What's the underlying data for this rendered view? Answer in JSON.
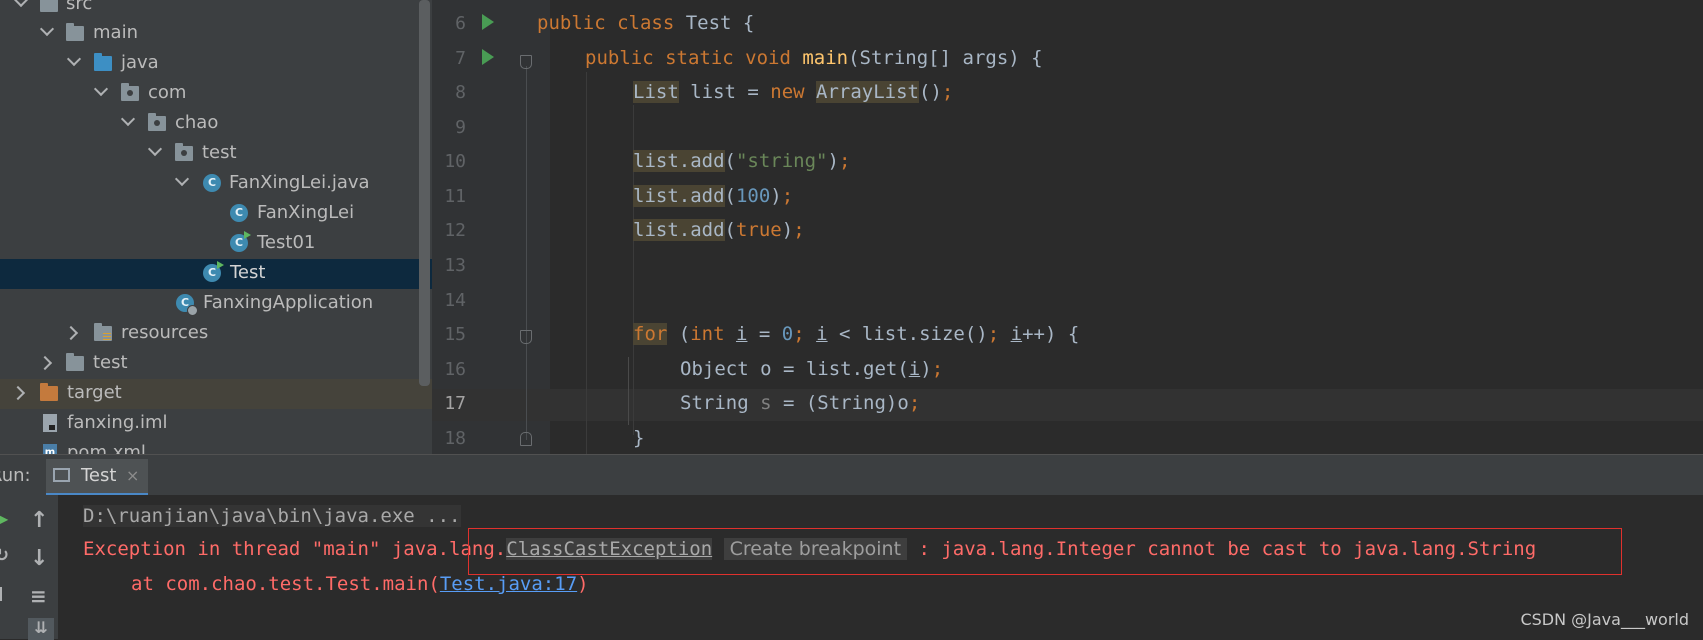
{
  "tree": [
    {
      "label": "src",
      "icon": "folder-icon",
      "expanded": true
    },
    {
      "label": "main",
      "icon": "folder-icon",
      "expanded": true
    },
    {
      "label": "java",
      "icon": "source-folder-icon",
      "expanded": true
    },
    {
      "label": "com",
      "icon": "package-icon",
      "expanded": true
    },
    {
      "label": "chao",
      "icon": "package-icon",
      "expanded": true
    },
    {
      "label": "test",
      "icon": "package-icon",
      "expanded": true
    },
    {
      "label": "FanXingLei.java",
      "icon": "class-file-icon",
      "expanded": true
    },
    {
      "label": "FanXingLei",
      "icon": "class-icon"
    },
    {
      "label": "Test01",
      "icon": "runnable-class-icon"
    },
    {
      "label": "Test",
      "icon": "runnable-class-icon",
      "selected": true
    },
    {
      "label": "FanxingApplication",
      "icon": "spring-app-class-icon"
    },
    {
      "label": "resources",
      "icon": "resources-folder-icon",
      "expanded": false
    },
    {
      "label": "test",
      "icon": "folder-icon",
      "expanded": false
    },
    {
      "label": "target",
      "icon": "excluded-folder-icon",
      "expanded": false
    },
    {
      "label": "fanxing.iml",
      "icon": "iml-file-icon"
    },
    {
      "label": "pom.xml",
      "icon": "maven-file-icon"
    }
  ],
  "editor": {
    "line_numbers": [
      "6",
      "7",
      "8",
      "9",
      "10",
      "11",
      "12",
      "13",
      "14",
      "15",
      "16",
      "17",
      "18"
    ],
    "current_line": "17"
  },
  "code": {
    "l6": {
      "kw": "public class ",
      "name": "Test {"
    },
    "l7": {
      "kw": "public static void ",
      "fn": "main",
      "rest": "(String[] args) {"
    },
    "l8": {
      "t1": "List",
      "t2": " list = ",
      "kw": "new ",
      "t3": "ArrayList",
      "t4": "()",
      "semi": ";"
    },
    "l10": {
      "a": "list.add",
      "b": "(",
      "s": "\"string\"",
      "c": ")",
      "semi": ";"
    },
    "l11": {
      "a": "list.add",
      "b": "(",
      "n": "100",
      "c": ")",
      "semi": ";"
    },
    "l12": {
      "a": "list.add",
      "b": "(",
      "k": "true",
      "c": ")",
      "semi": ";"
    },
    "l15": {
      "kw": "for",
      "p1": " (",
      "kw2": "int ",
      "v1": "i",
      "p2": " = ",
      "n": "0",
      "semi1": "; ",
      "v2": "i",
      "p3": " < list.size()",
      "semi2": "; ",
      "v3": "i",
      "p4": "++) {"
    },
    "l16": {
      "a": "Object o = list.get(",
      "v": "i",
      "b": ")",
      "semi": ";"
    },
    "l17": {
      "a": "String ",
      "v": "s",
      "b": " = (String)o",
      "semi": ";"
    },
    "l18": {
      "a": "}"
    }
  },
  "run": {
    "label": "Run:",
    "tab_label": "Test",
    "close": "×"
  },
  "console": {
    "cmd": "D:\\ruanjian\\java\\bin\\java.exe ...",
    "exc_prefix": "Exception in thread \"main\" java.lang.",
    "exc_class": "ClassCastException",
    "breakpoint_hint": "Create breakpoint",
    "exc_suffix": " : java.lang.Integer cannot be cast to java.lang.String",
    "at_prefix": "at com.chao.test.Test.main(",
    "at_link": "Test.java:17",
    "at_suffix": ")"
  },
  "watermark": "CSDN @Java___world"
}
